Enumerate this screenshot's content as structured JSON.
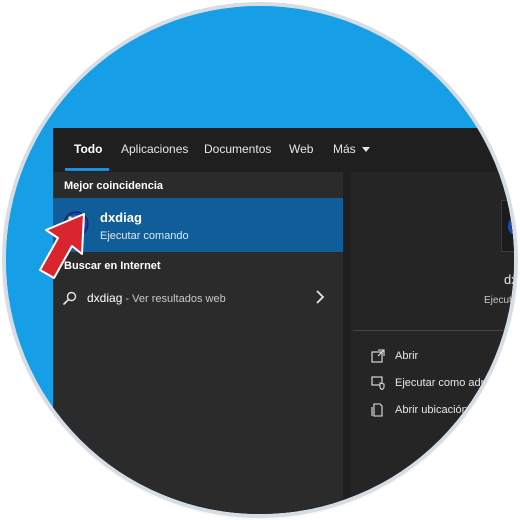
{
  "tabs": [
    {
      "label": "Todo",
      "active": true
    },
    {
      "label": "Aplicaciones",
      "active": false
    },
    {
      "label": "Documentos",
      "active": false
    },
    {
      "label": "Web",
      "active": false
    },
    {
      "label": "Más",
      "active": false
    }
  ],
  "best_match": {
    "heading": "Mejor coincidencia",
    "name": "dxdiag",
    "subtitle": "Ejecutar comando"
  },
  "internet": {
    "heading": "Buscar en Internet",
    "query": "dxdiag",
    "suffix": " - Ver resultados web"
  },
  "details": {
    "name": "dx",
    "subtitle": "Ejecuta",
    "actions": [
      {
        "label": "Abrir",
        "icon": "open-icon"
      },
      {
        "label": "Ejecutar como admi",
        "icon": "admin-shield-icon"
      },
      {
        "label": "Abrir ubicación",
        "icon": "file-location-icon"
      }
    ]
  },
  "colors": {
    "accent": "#1a8fe0",
    "selection": "#0f5e9a",
    "arrow": "#d9262e"
  }
}
